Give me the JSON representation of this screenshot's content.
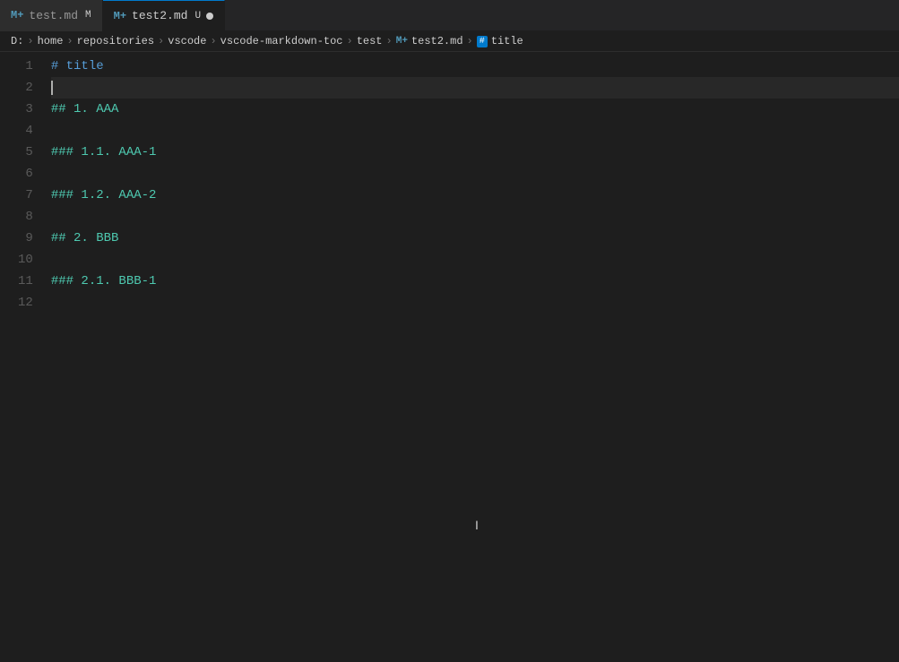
{
  "tabs": [
    {
      "id": "test-md",
      "label": "test.md",
      "icon": "M+",
      "badge": "M",
      "active": false,
      "modified": false
    },
    {
      "id": "test2-md",
      "label": "test2.md",
      "icon": "M+",
      "badge": "U",
      "active": true,
      "modified": true
    }
  ],
  "breadcrumb": {
    "items": [
      {
        "type": "text",
        "label": "D:"
      },
      {
        "type": "separator",
        "label": ">"
      },
      {
        "type": "text",
        "label": "home"
      },
      {
        "type": "separator",
        "label": ">"
      },
      {
        "type": "text",
        "label": "repositories"
      },
      {
        "type": "separator",
        "label": ">"
      },
      {
        "type": "text",
        "label": "vscode"
      },
      {
        "type": "separator",
        "label": ">"
      },
      {
        "type": "text",
        "label": "vscode-markdown-toc"
      },
      {
        "type": "separator",
        "label": ">"
      },
      {
        "type": "text",
        "label": "test"
      },
      {
        "type": "separator",
        "label": ">"
      },
      {
        "type": "md-icon",
        "label": "M+"
      },
      {
        "type": "text",
        "label": "test2.md"
      },
      {
        "type": "separator",
        "label": ">"
      },
      {
        "type": "symbol-icon",
        "label": "#"
      },
      {
        "type": "text",
        "label": "title"
      }
    ]
  },
  "lines": [
    {
      "num": "1",
      "content": "# title",
      "type": "h1"
    },
    {
      "num": "2",
      "content": "",
      "type": "cursor"
    },
    {
      "num": "3",
      "content": "## 1. AAA",
      "type": "h2"
    },
    {
      "num": "4",
      "content": "",
      "type": "empty"
    },
    {
      "num": "5",
      "content": "### 1.1. AAA-1",
      "type": "h3"
    },
    {
      "num": "6",
      "content": "",
      "type": "empty"
    },
    {
      "num": "7",
      "content": "### 1.2. AAA-2",
      "type": "h3"
    },
    {
      "num": "8",
      "content": "",
      "type": "empty"
    },
    {
      "num": "9",
      "content": "## 2. BBB",
      "type": "h2"
    },
    {
      "num": "10",
      "content": "",
      "type": "empty"
    },
    {
      "num": "11",
      "content": "### 2.1. BBB-1",
      "type": "h3"
    },
    {
      "num": "12",
      "content": "",
      "type": "empty"
    }
  ],
  "colors": {
    "h1": "#569cd6",
    "h2": "#4ec9b0",
    "h3": "#4ec9b0",
    "lineNumber": "#5a5a5a",
    "background": "#1e1e1e",
    "tabActive": "#1e1e1e",
    "tabInactive": "#2d2d2d",
    "accent": "#007acc"
  }
}
